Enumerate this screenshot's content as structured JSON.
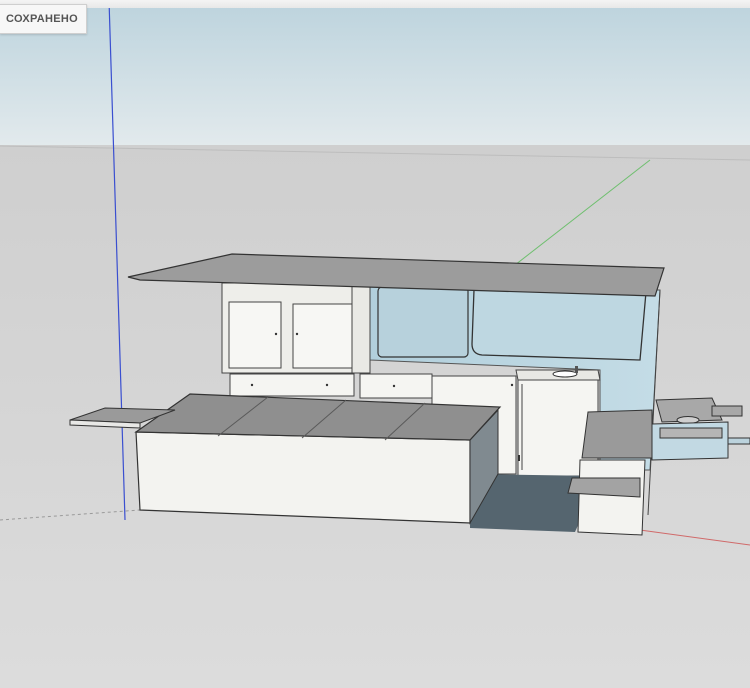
{
  "status": {
    "saved_label": "СОХРАНЕНО"
  },
  "scene": {
    "sky_color": "#c9dbe2",
    "ground_color": "#d4d4d4",
    "axis_blue": "#3a4fd0",
    "axis_green": "#6fbf6f",
    "axis_red": "#d06a6a",
    "wall_color": "#b8d3df",
    "cabinet_color": "#f3f3f0",
    "roof_color": "#9b9b9b",
    "bed_top_color": "#8e8e8e",
    "floor_color": "#5f6f7a"
  }
}
